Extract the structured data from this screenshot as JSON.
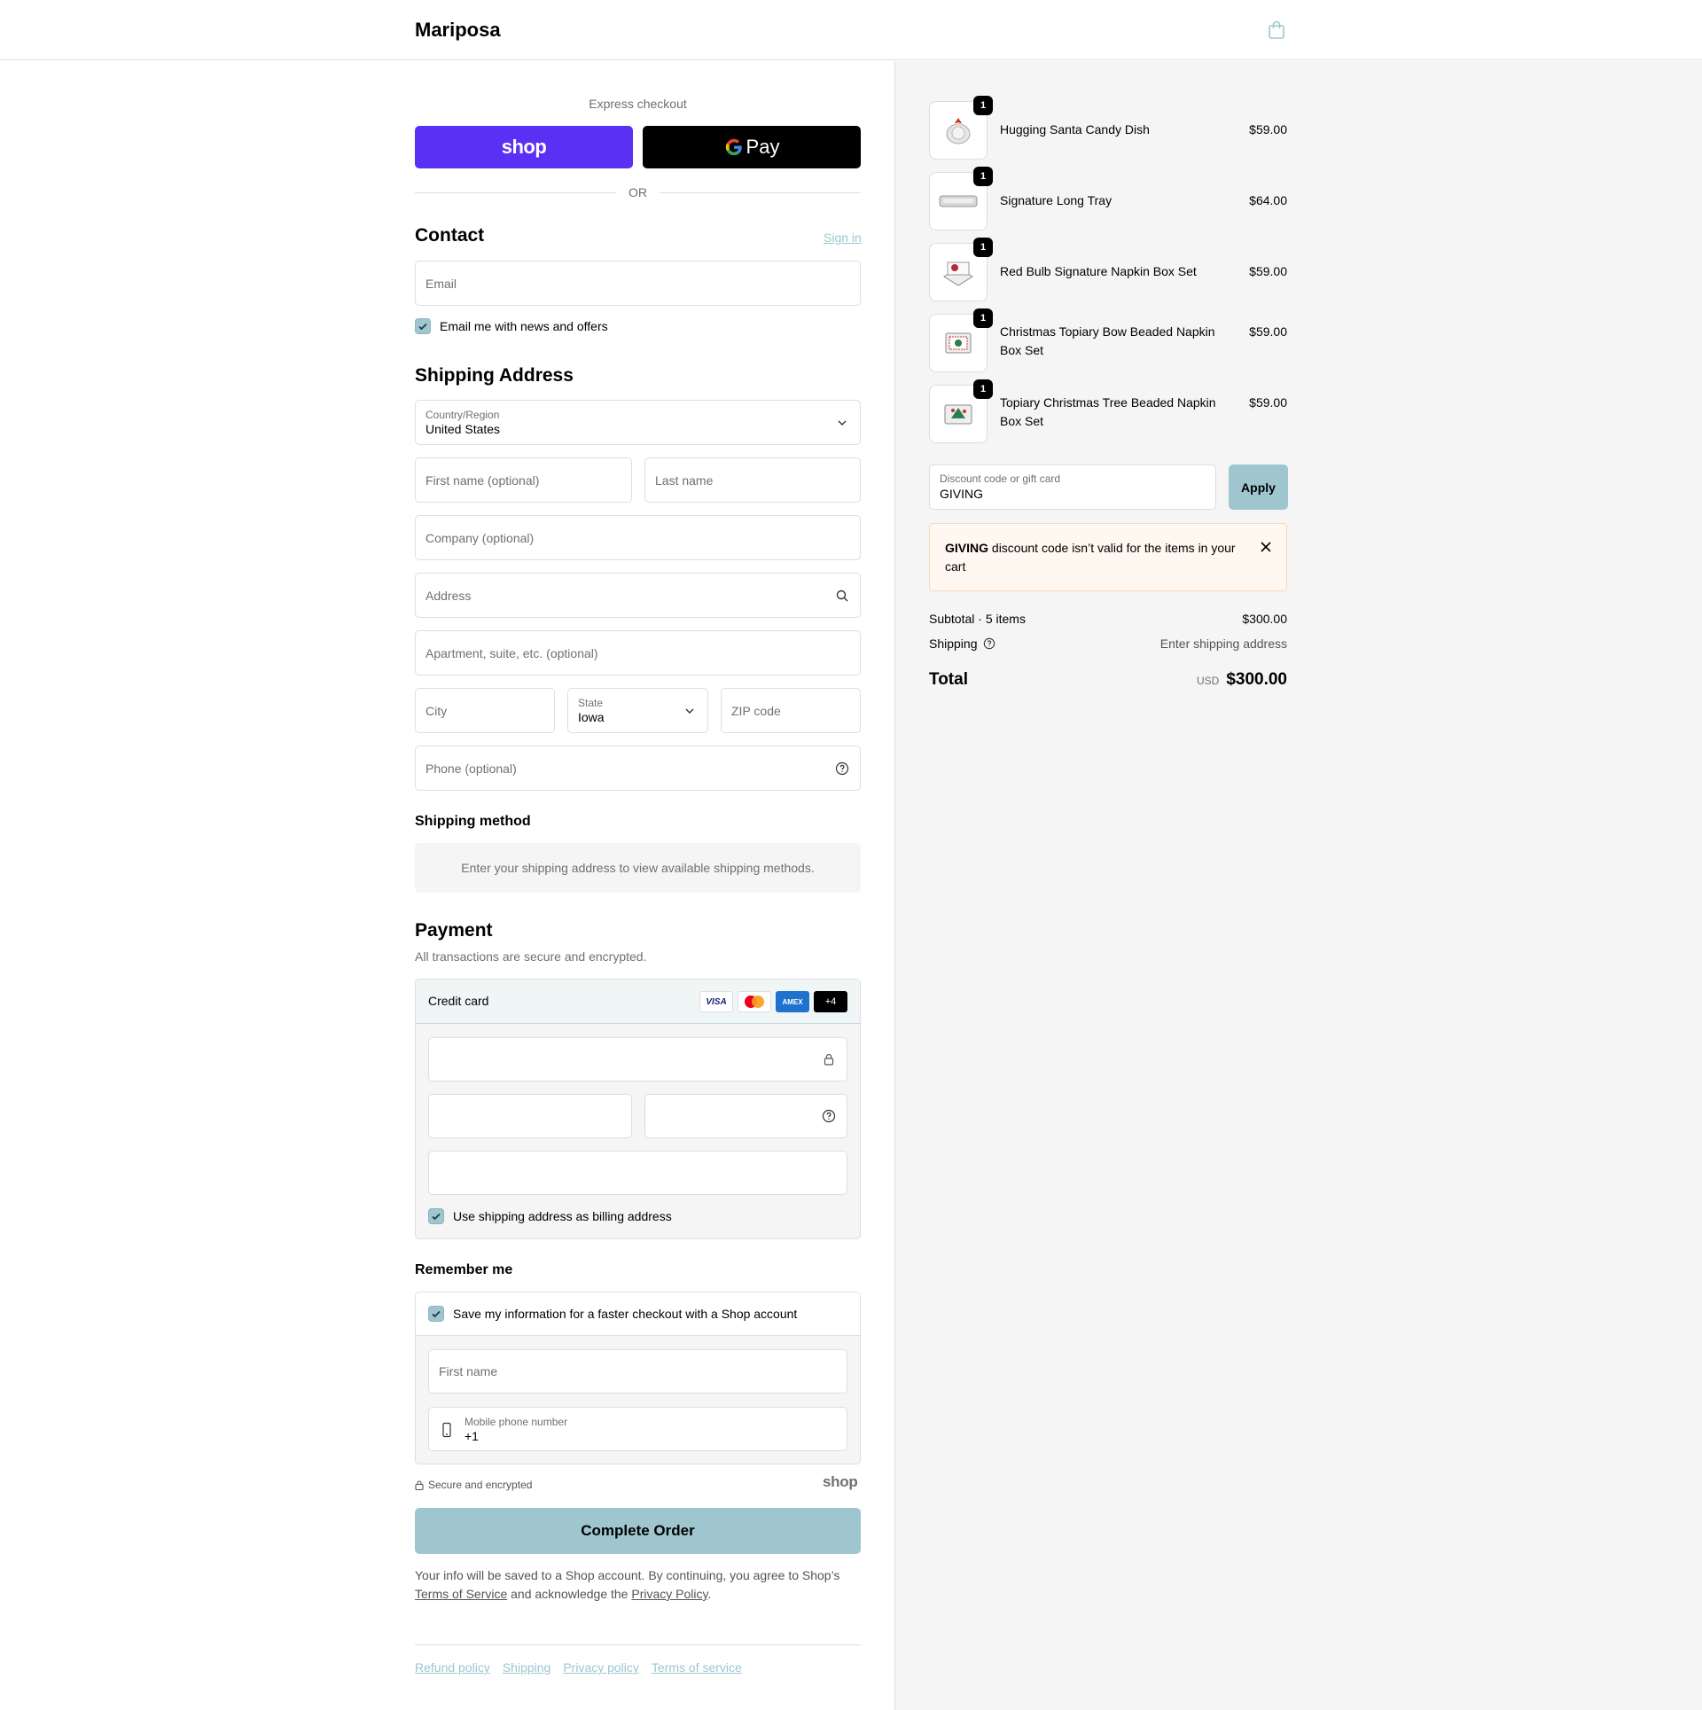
{
  "header": {
    "brand": "Mariposa"
  },
  "express": {
    "label": "Express checkout",
    "shop_label": "shop",
    "gpay_label": "Pay",
    "or_text": "OR"
  },
  "contact": {
    "title": "Contact",
    "sign_in": "Sign in",
    "email_placeholder": "Email",
    "newsletter_label": "Email me with news and offers"
  },
  "shipping_address": {
    "title": "Shipping Address",
    "country_label": "Country/Region",
    "country_value": "United States",
    "first_name_placeholder": "First name (optional)",
    "last_name_placeholder": "Last name",
    "company_placeholder": "Company (optional)",
    "address_placeholder": "Address",
    "apartment_placeholder": "Apartment, suite, etc. (optional)",
    "city_placeholder": "City",
    "state_label": "State",
    "state_value": "Iowa",
    "zip_placeholder": "ZIP code",
    "phone_placeholder": "Phone (optional)"
  },
  "shipping_method": {
    "title": "Shipping method",
    "message": "Enter your shipping address to view available shipping methods."
  },
  "payment": {
    "title": "Payment",
    "subtitle": "All transactions are secure and encrypted.",
    "method_label": "Credit card",
    "card_logos": [
      "VISA",
      "",
      "AMEX",
      "+4"
    ],
    "billing_label": "Use shipping address as billing address"
  },
  "remember": {
    "title": "Remember me",
    "save_label": "Save my information for a faster checkout with a Shop account",
    "first_name_placeholder": "First name",
    "mobile_label": "Mobile phone number",
    "mobile_value": "+1"
  },
  "secure": {
    "text": "Secure and encrypted",
    "shop_mark": "shop"
  },
  "complete_button": "Complete Order",
  "legal": {
    "text1": "Your info will be saved to a Shop account. By continuing, you agree to Shop’s ",
    "terms": "Terms of Service",
    "text2": " and acknowledge the ",
    "privacy": "Privacy Policy",
    "text3": "."
  },
  "footer": {
    "links": [
      "Refund policy",
      "Shipping",
      "Privacy policy",
      "Terms of service"
    ]
  },
  "cart": {
    "items": [
      {
        "name": "Hugging Santa Candy Dish",
        "price": "$59.00",
        "qty": "1"
      },
      {
        "name": "Signature Long Tray",
        "price": "$64.00",
        "qty": "1"
      },
      {
        "name": "Red Bulb Signature Napkin Box Set",
        "price": "$59.00",
        "qty": "1"
      },
      {
        "name": "Christmas Topiary Bow Beaded Napkin Box Set",
        "price": "$59.00",
        "qty": "1"
      },
      {
        "name": "Topiary Christmas Tree Beaded Napkin Box Set",
        "price": "$59.00",
        "qty": "1"
      }
    ],
    "discount_label": "Discount code or gift card",
    "discount_value": "GIVING",
    "apply_label": "Apply",
    "alert_code": "GIVING",
    "alert_text": " discount code isn’t valid for the items in your cart",
    "subtotal_label": "Subtotal · 5 items",
    "subtotal_value": "$300.00",
    "shipping_label": "Shipping",
    "shipping_value": "Enter shipping address",
    "total_label": "Total",
    "currency": "USD",
    "total_value": "$300.00"
  },
  "colors": {
    "accent": "#9fc6cf",
    "shop_purple": "#5a31f4",
    "alert_bg": "#fff8f0"
  }
}
